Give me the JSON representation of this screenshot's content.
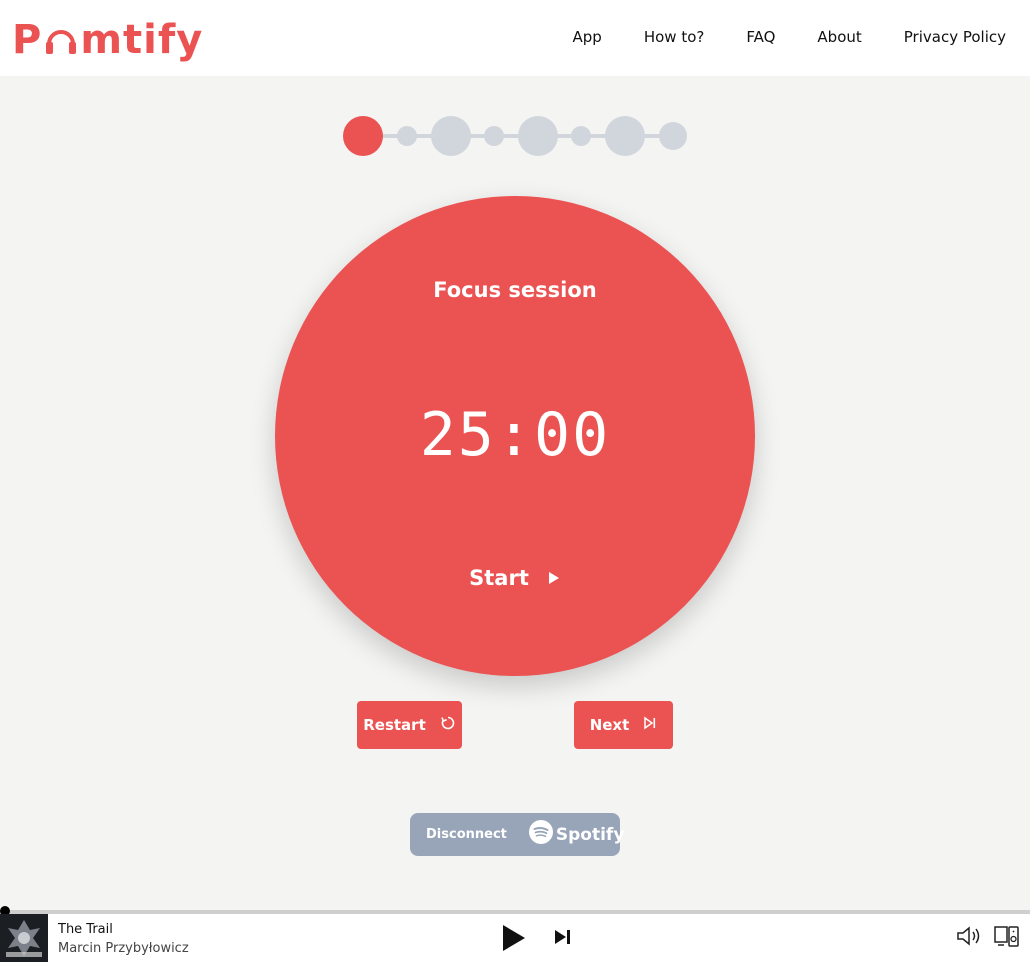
{
  "header": {
    "logo_text_left": "P",
    "logo_text_right": "mtify",
    "nav": [
      "App",
      "How to?",
      "FAQ",
      "About",
      "Privacy Policy"
    ]
  },
  "progress": {
    "steps_total": 8,
    "current_step": 1
  },
  "timer": {
    "session_label": "Focus session",
    "time": "25:00",
    "start_label": "Start"
  },
  "controls": {
    "restart_label": "Restart",
    "next_label": "Next"
  },
  "spotify": {
    "disconnect_label": "Disconnect",
    "brand": "Spotify"
  },
  "player": {
    "track_title": "The Trail",
    "artist": "Marcin Przybyłowicz",
    "album_art_icon": "witcher-album-art"
  },
  "colors": {
    "accent": "#eb5252",
    "inactive_dot": "#d1d5dc",
    "spotify_button": "#98a5b8",
    "background": "#f4f4f3"
  }
}
